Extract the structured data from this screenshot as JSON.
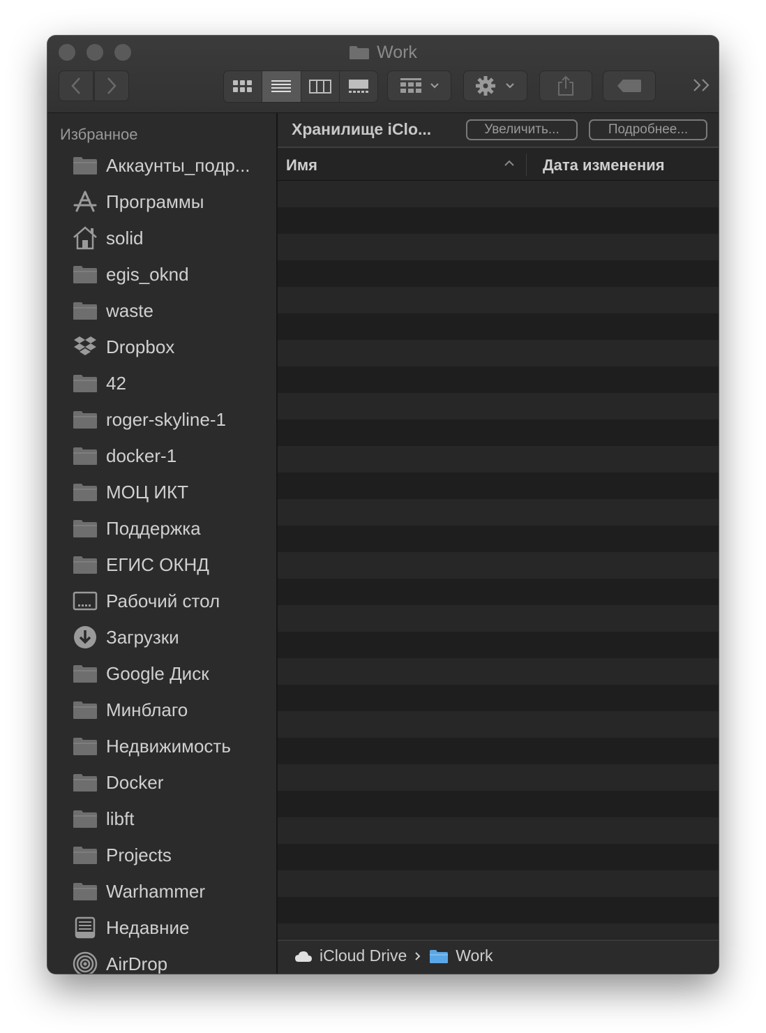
{
  "window": {
    "title": "Work"
  },
  "sidebar": {
    "heading": "Избранное",
    "items": [
      {
        "label": "Аккаунты_подр...",
        "icon": "folder-icon"
      },
      {
        "label": "Программы",
        "icon": "applications-icon"
      },
      {
        "label": "solid",
        "icon": "home-icon"
      },
      {
        "label": "egis_oknd",
        "icon": "folder-icon"
      },
      {
        "label": "waste",
        "icon": "folder-icon"
      },
      {
        "label": "Dropbox",
        "icon": "dropbox-icon"
      },
      {
        "label": "42",
        "icon": "folder-icon"
      },
      {
        "label": "roger-skyline-1",
        "icon": "folder-icon"
      },
      {
        "label": "docker-1",
        "icon": "folder-icon"
      },
      {
        "label": "МОЦ ИКТ",
        "icon": "folder-icon"
      },
      {
        "label": "Поддержка",
        "icon": "folder-icon"
      },
      {
        "label": "ЕГИС ОКНД",
        "icon": "folder-icon"
      },
      {
        "label": "Рабочий стол",
        "icon": "desktop-icon"
      },
      {
        "label": "Загрузки",
        "icon": "downloads-icon"
      },
      {
        "label": "Google Диск",
        "icon": "folder-icon"
      },
      {
        "label": "Минблаго",
        "icon": "folder-icon"
      },
      {
        "label": "Недвижимость",
        "icon": "folder-icon"
      },
      {
        "label": "Docker",
        "icon": "folder-icon"
      },
      {
        "label": "libft",
        "icon": "folder-icon"
      },
      {
        "label": "Projects",
        "icon": "folder-icon"
      },
      {
        "label": "Warhammer",
        "icon": "folder-icon"
      },
      {
        "label": "Недавние",
        "icon": "recents-icon"
      },
      {
        "label": "AirDrop",
        "icon": "airdrop-icon"
      }
    ]
  },
  "storage_bar": {
    "title": "Хранилище iClo...",
    "upgrade_label": "Увеличить...",
    "details_label": "Подробнее..."
  },
  "columns": {
    "name": "Имя",
    "date_modified": "Дата изменения"
  },
  "pathbar": {
    "root": "iCloud Drive",
    "current": "Work"
  }
}
